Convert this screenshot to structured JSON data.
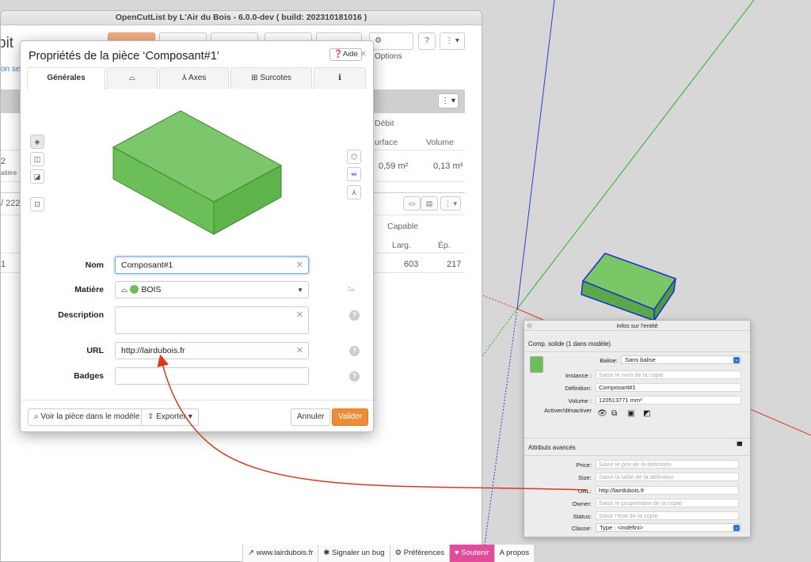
{
  "window": {
    "title": "OpenCutList by L'Air du Bois - 6.0.0-dev ( build: 202310181016 )"
  },
  "background": {
    "toolbar": {
      "options_label": "Options",
      "help_label": "?",
      "menu_label": "⋮ ▾"
    },
    "title_fragment": "bit",
    "subtitle_fragment": "on seu",
    "headers": {
      "debit": "Débit",
      "surface": "urface",
      "volume": "Volume",
      "capable": "Capable",
      "larg": "Larg.",
      "ep": "Ép."
    },
    "values": {
      "row_a_num": "2",
      "row_a_sub": "atière",
      "surface_val": "0,59 m²",
      "volume_val": "0,13 m³",
      "group_label": "/ 222",
      "row_b_num": "1",
      "larg_val": "603",
      "ep_val": "217"
    }
  },
  "footer": {
    "site": "www.lairdubois.fr",
    "bug": "Signaler un bug",
    "prefs": "Préférences",
    "support": "Soutenir",
    "about": "A propos"
  },
  "dialog": {
    "title": "Propriétés de la pièce ‘Composant#1’",
    "help_label": "Aide",
    "close": "×",
    "tabs": [
      {
        "label": "Générales",
        "active": true
      },
      {
        "label": "",
        "active": false
      },
      {
        "label": "Axes",
        "active": false
      },
      {
        "label": "Surcotes",
        "active": false
      },
      {
        "label": "",
        "active": false
      }
    ],
    "fields": {
      "name_label": "Nom",
      "name_value": "Composant#1",
      "material_label": "Matière",
      "material_value": "BOIS",
      "material_color": "#6cbf58",
      "description_label": "Description",
      "description_value": "",
      "url_label": "URL",
      "url_value": "http://lairdubois.fr",
      "badges_label": "Badges",
      "badges_value": ""
    },
    "buttons": {
      "view_in_model": "Voir la pièce dans le modèle",
      "export": "Exporter",
      "cancel": "Annuler",
      "validate": "Valider"
    },
    "preview_color": "#6cbf58"
  },
  "entity_info": {
    "title": "Infos sur l'entité",
    "summary": "Comp. solide (1 dans modèle)",
    "balise_label": "Balise:",
    "balise_value": "Sans balise",
    "instance_label": "Instance :",
    "instance_placeholder": "Saisir le nom de la copie",
    "definition_label": "Définition:",
    "definition_value": "Composant#1",
    "volume_label": "Volume :",
    "volume_value": "120513771 mm³",
    "toggle_label": "Activer/désactiver",
    "advanced_label": "Attributs avancés",
    "attributes": [
      {
        "label": "Price:",
        "value": "Saisir le prix de la définition",
        "placeholder": true
      },
      {
        "label": "Size:",
        "value": "Saisir la taille de la définition",
        "placeholder": true
      },
      {
        "label": "URL:",
        "value": "http://lairdubois.fr",
        "placeholder": false
      },
      {
        "label": "Owner:",
        "value": "Saisir le propriétaire de la copie",
        "placeholder": true
      },
      {
        "label": "Status:",
        "value": "Saisir l'état de la copie",
        "placeholder": true
      }
    ],
    "classe_label": "Classe:",
    "classe_value": "Type : <indéfini>"
  },
  "colors": {
    "accent_orange": "#ee8b36",
    "support_pink": "#e24c9a",
    "component_green": "#6cbf58",
    "arrow_red": "#d6391f"
  }
}
